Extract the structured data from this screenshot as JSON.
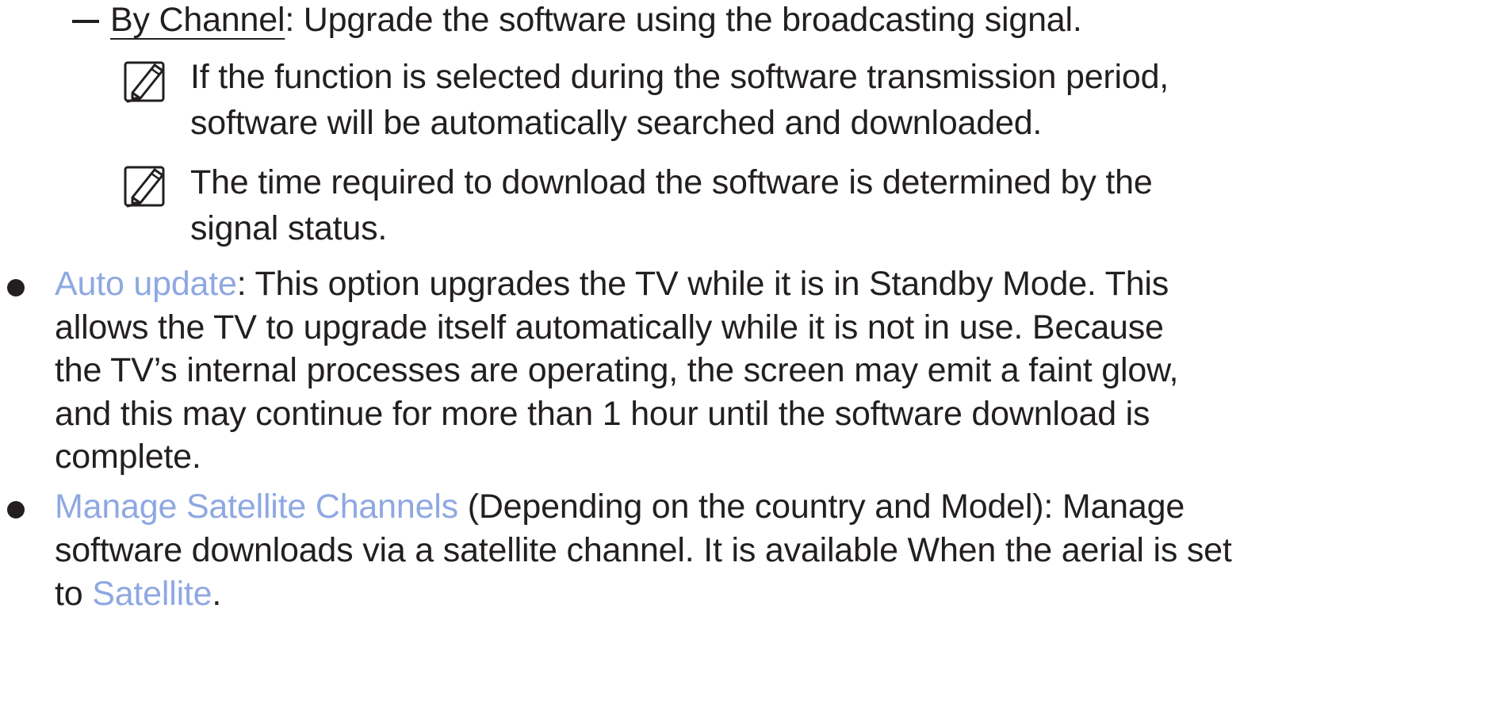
{
  "sub_item": {
    "term": "By Channel",
    "text": ": Upgrade the software using the broadcasting signal."
  },
  "notes": [
    {
      "icon": "note-icon",
      "line1": "If the function is selected during the software transmission period,",
      "line2": "software will be automatically searched and downloaded."
    },
    {
      "icon": "note-icon",
      "line1": "The time required to download the software is determined by the",
      "line2": "signal status."
    }
  ],
  "bullets": [
    {
      "link": "Auto update",
      "lines": [
        ": This option upgrades the TV while it is in Standby Mode. This",
        "allows the TV to upgrade itself automatically while it is not in use. Because",
        "the TV’s internal processes are operating, the screen may emit a faint glow,",
        "and this may continue for more than 1 hour until the software download is",
        "complete."
      ]
    },
    {
      "link": "Manage Satellite Channels",
      "line1_rest": " (Depending on the country and Model): Manage",
      "line2": "software downloads via a satellite channel. It is available When the aerial is set",
      "line3_prefix": "to ",
      "line3_link": "Satellite",
      "line3_suffix": "."
    }
  ],
  "colors": {
    "text": "#231f20",
    "link": "#8ea8e2"
  }
}
